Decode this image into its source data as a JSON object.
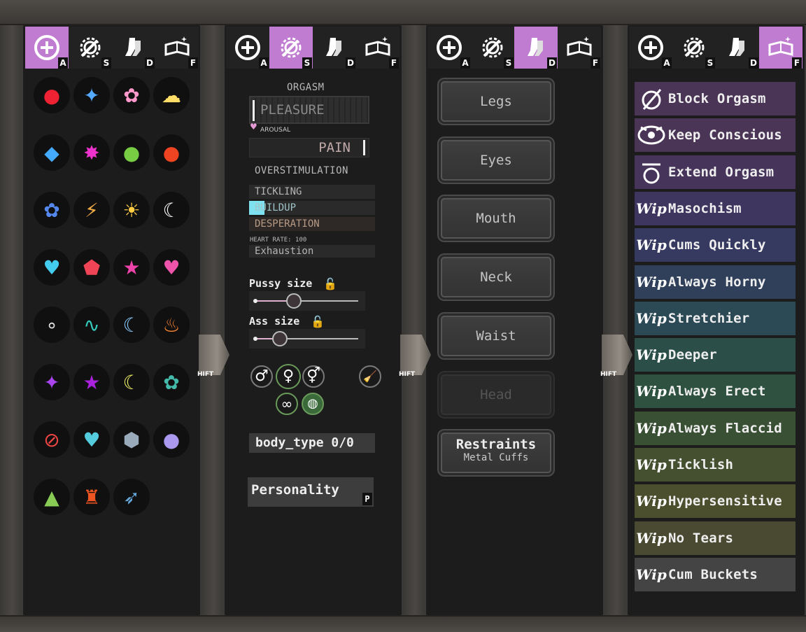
{
  "tabs": [
    {
      "icon": "plus-circle-icon",
      "key": "A"
    },
    {
      "icon": "gear-wrench-icon",
      "key": "S"
    },
    {
      "icon": "socks-icon",
      "key": "D"
    },
    {
      "icon": "book-sparkle-icon",
      "key": "F"
    }
  ],
  "shift_label": "HIFT",
  "cutie_marks": [
    "apples-mark-icon",
    "rainbow-bolt-mark-icon",
    "butterflies-mark-icon",
    "balloons-mark-icon",
    "diamonds-mark-icon",
    "sparkle-mark-icon",
    "green-apple-mark-icon",
    "red-apple-mark-icon",
    "blue-flowers-mark-icon",
    "storm-bolt-mark-icon",
    "sun-mark-icon",
    "moon-mark-icon",
    "heart-gem-mark-icon",
    "shield-bolt-mark-icon",
    "shield-star-mark-icon",
    "shield-heart-mark-icon",
    "bubbles-mark-icon",
    "swirl-star-mark-icon",
    "star-moon-mark-icon",
    "flame-mark-icon",
    "twilight-star-mark-icon",
    "purple-stars-mark-icon",
    "yellow-moon-mark-icon",
    "turtles-mark-icon",
    "no-entry-mark-icon",
    "leaf-heart-mark-icon",
    "gem-shield-mark-icon",
    "grapes-mark-icon",
    "cactus-mark-icon",
    "tower-mark-icon",
    "bird-mark-icon"
  ],
  "stats": {
    "orgasm": "ORGASM",
    "pleasure": "PLEASURE",
    "arousal": "AROUSAL",
    "pain": "PAIN",
    "overstimulation": "OVERSTIMULATION",
    "tickling": "TICKLING",
    "buildup": "BUILDUP",
    "desperation": "DESPERATION",
    "heart_rate": "HEART RATE: 100",
    "exhaustion": "Exhaustion",
    "pussy_size": "Pussy size",
    "ass_size": "Ass size",
    "pussy_level": 0.38,
    "ass_level": 0.24,
    "body_type": "body_type 0/0",
    "personality": "Personality",
    "personality_key": "P",
    "sym_male": "♂",
    "sym_female": "♀",
    "sym_both": "⚥"
  },
  "slots": [
    "Legs",
    "Eyes",
    "Mouth",
    "Neck",
    "Waist",
    "Head"
  ],
  "restraints": {
    "title": "Restraints",
    "sub": "Metal Cuffs"
  },
  "perks": [
    {
      "label": "Block Orgasm",
      "icon": "block-orgasm-icon",
      "color": "#4a3556"
    },
    {
      "label": "Keep Conscious",
      "icon": "eye-icon",
      "color": "#4a3556"
    },
    {
      "label": "Extend Orgasm",
      "icon": "extend-icon",
      "color": "#46345a"
    },
    {
      "label": "Masochism",
      "icon": "wip-icon",
      "color": "#3f3660"
    },
    {
      "label": "Cums Quickly",
      "icon": "wip-icon",
      "color": "#373a60"
    },
    {
      "label": "Always Horny",
      "icon": "wip-icon",
      "color": "#30405a"
    },
    {
      "label": "Stretchier",
      "icon": "wip-icon",
      "color": "#2c4956"
    },
    {
      "label": "Deeper",
      "icon": "wip-icon",
      "color": "#2b4f48"
    },
    {
      "label": "Always Erect",
      "icon": "wip-icon",
      "color": "#2e5140"
    },
    {
      "label": "Always Flaccid",
      "icon": "wip-icon",
      "color": "#3a5035"
    },
    {
      "label": "Ticklish",
      "icon": "wip-icon",
      "color": "#44502f"
    },
    {
      "label": "Hypersensitive",
      "icon": "wip-icon",
      "color": "#4b4f2d"
    },
    {
      "label": "No Tears",
      "icon": "wip-icon",
      "color": "#4a4a32"
    },
    {
      "label": "Cum Buckets",
      "icon": "wip-icon",
      "color": "#444444"
    }
  ],
  "wip_text": "Wip"
}
